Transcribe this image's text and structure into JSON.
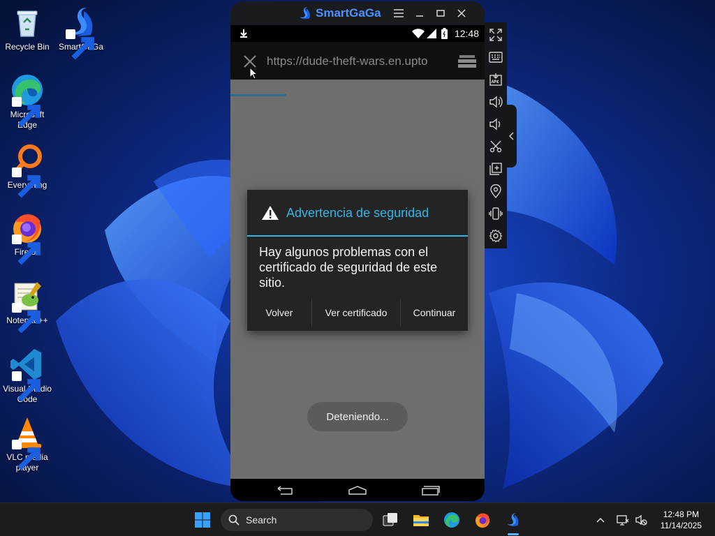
{
  "desktop": {
    "icons": [
      {
        "label": "Recycle Bin",
        "icon": "recycle-bin-icon"
      },
      {
        "label": "SmartGaGa",
        "icon": "smartgaga-icon"
      },
      {
        "label": "Microsoft Edge",
        "icon": "edge-icon"
      },
      {
        "label": "Everything",
        "icon": "everything-icon"
      },
      {
        "label": "Firefox",
        "icon": "firefox-icon"
      },
      {
        "label": "Notepad++",
        "icon": "notepadpp-icon"
      },
      {
        "label": "Visual Studio Code",
        "icon": "vscode-icon"
      },
      {
        "label": "VLC media player",
        "icon": "vlc-icon"
      }
    ]
  },
  "emulator": {
    "title": "SmartGaGa",
    "brand_color": "#4b92ff",
    "status_bar": {
      "time": "12:48"
    },
    "browser": {
      "url": "https://dude-theft-wars.en.upto"
    },
    "dialog": {
      "title": "Advertencia de seguridad",
      "message": "Hay algunos problemas con el certificado de seguridad de este sitio.",
      "buttons": [
        "Volver",
        "Ver certificado",
        "Continuar"
      ],
      "accent_color": "#33b5e5"
    },
    "toast": "Deteniendo..."
  },
  "taskbar": {
    "search_label": "Search",
    "clock_time": "12:48 PM",
    "clock_date": "11/14/2025"
  }
}
